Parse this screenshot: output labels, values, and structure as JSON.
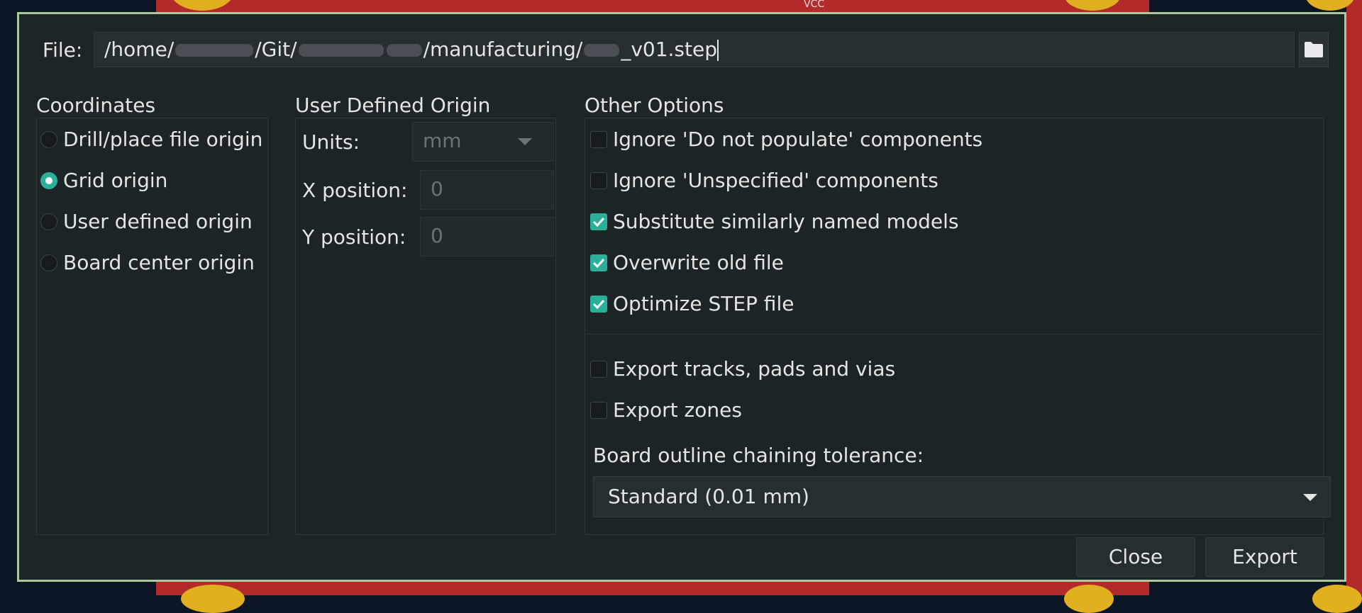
{
  "file": {
    "label": "File:",
    "path_part1": "/home/",
    "path_part2": "/Git/",
    "path_part3": "/manufacturing/",
    "path_part4": "_v01.step"
  },
  "coordinates": {
    "title": "Coordinates",
    "options": [
      {
        "label": "Drill/place file origin",
        "selected": false
      },
      {
        "label": "Grid origin",
        "selected": true
      },
      {
        "label": "User defined origin",
        "selected": false
      },
      {
        "label": "Board center origin",
        "selected": false
      }
    ]
  },
  "user_origin": {
    "title": "User Defined Origin",
    "units_label": "Units:",
    "units_value": "mm",
    "x_label": "X position:",
    "x_value": "0",
    "y_label": "Y position:",
    "y_value": "0"
  },
  "other_options": {
    "title": "Other Options",
    "checks": [
      {
        "label": "Ignore 'Do not populate' components",
        "checked": false
      },
      {
        "label": "Ignore 'Unspecified' components",
        "checked": false
      },
      {
        "label": "Substitute similarly named models",
        "checked": true
      },
      {
        "label": "Overwrite old file",
        "checked": true
      },
      {
        "label": "Optimize STEP file",
        "checked": true
      },
      {
        "label": "Export tracks, pads and vias",
        "checked": false
      },
      {
        "label": "Export zones",
        "checked": false
      }
    ],
    "tolerance_label": "Board outline chaining tolerance:",
    "tolerance_value": "Standard (0.01 mm)"
  },
  "buttons": {
    "close": "Close",
    "export": "Export"
  },
  "background_text": {
    "vcc": "VCC"
  },
  "colors": {
    "accent": "#2ab09a",
    "dialog_border": "#a9c99a"
  }
}
